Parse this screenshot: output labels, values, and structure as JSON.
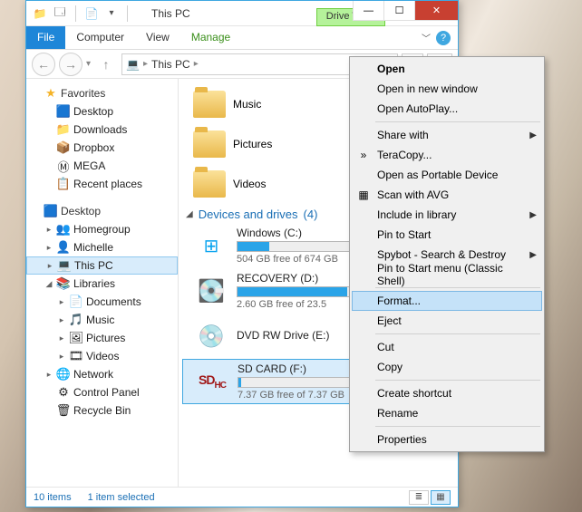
{
  "titlebar": {
    "title": "This PC",
    "drive_tools": "Drive Tools"
  },
  "ribbon": {
    "file": "File",
    "computer": "Computer",
    "view": "View",
    "manage": "Manage"
  },
  "address": {
    "root_icon": "💻",
    "location": "This PC"
  },
  "tree": {
    "favorites": {
      "label": "Favorites",
      "items": [
        {
          "label": "Desktop",
          "icon": "🟦"
        },
        {
          "label": "Downloads",
          "icon": "📁"
        },
        {
          "label": "Dropbox",
          "icon": "📦"
        },
        {
          "label": "MEGA",
          "icon": "Ⓜ"
        },
        {
          "label": "Recent places",
          "icon": "📋"
        }
      ]
    },
    "desktop": {
      "label": "Desktop",
      "items": [
        {
          "label": "Homegroup",
          "icon": "👥"
        },
        {
          "label": "Michelle",
          "icon": "👤"
        },
        {
          "label": "This PC",
          "icon": "💻",
          "selected": true
        },
        {
          "label": "Libraries",
          "icon": "📚",
          "expanded": true,
          "children": [
            {
              "label": "Documents",
              "icon": "📄"
            },
            {
              "label": "Music",
              "icon": "🎵"
            },
            {
              "label": "Pictures",
              "icon": "🖼"
            },
            {
              "label": "Videos",
              "icon": "🎞"
            }
          ]
        },
        {
          "label": "Network",
          "icon": "🌐"
        },
        {
          "label": "Control Panel",
          "icon": "⚙"
        },
        {
          "label": "Recycle Bin",
          "icon": "🗑"
        }
      ]
    }
  },
  "content": {
    "folders": [
      {
        "label": "Music"
      },
      {
        "label": "Pictures"
      },
      {
        "label": "Videos"
      }
    ],
    "section": {
      "label": "Devices and drives",
      "count": "(4)"
    },
    "drives": [
      {
        "name": "Windows (C:)",
        "free": "504 GB free of 674 GB",
        "fill": 25,
        "icon": "win"
      },
      {
        "name": "RECOVERY (D:)",
        "free": "2.60 GB free of 23.5",
        "fill": 88,
        "icon": "hdd"
      },
      {
        "name": "DVD RW Drive (E:)",
        "free": "",
        "fill": 0,
        "icon": "dvd"
      },
      {
        "name": "SD CARD (F:)",
        "free": "7.37 GB free of 7.37 GB",
        "fill": 2,
        "icon": "sd",
        "selected": true
      }
    ]
  },
  "status": {
    "items": "10 items",
    "selected": "1 item selected"
  },
  "ctx": {
    "items": [
      {
        "label": "Open",
        "bold": true
      },
      {
        "label": "Open in new window"
      },
      {
        "label": "Open AutoPlay..."
      },
      {
        "sep": true
      },
      {
        "label": "Share with",
        "sub": true
      },
      {
        "label": "TeraCopy...",
        "icon": "»"
      },
      {
        "label": "Open as Portable Device"
      },
      {
        "label": "Scan with AVG",
        "icon": "▦"
      },
      {
        "label": "Include in library",
        "sub": true
      },
      {
        "label": "Pin to Start"
      },
      {
        "label": "Spybot - Search & Destroy",
        "sub": true
      },
      {
        "label": "Pin to Start menu (Classic Shell)"
      },
      {
        "sep": true
      },
      {
        "label": "Format...",
        "hover": true
      },
      {
        "label": "Eject"
      },
      {
        "sep": true
      },
      {
        "label": "Cut"
      },
      {
        "label": "Copy"
      },
      {
        "sep": true
      },
      {
        "label": "Create shortcut"
      },
      {
        "label": "Rename"
      },
      {
        "sep": true
      },
      {
        "label": "Properties"
      }
    ]
  }
}
